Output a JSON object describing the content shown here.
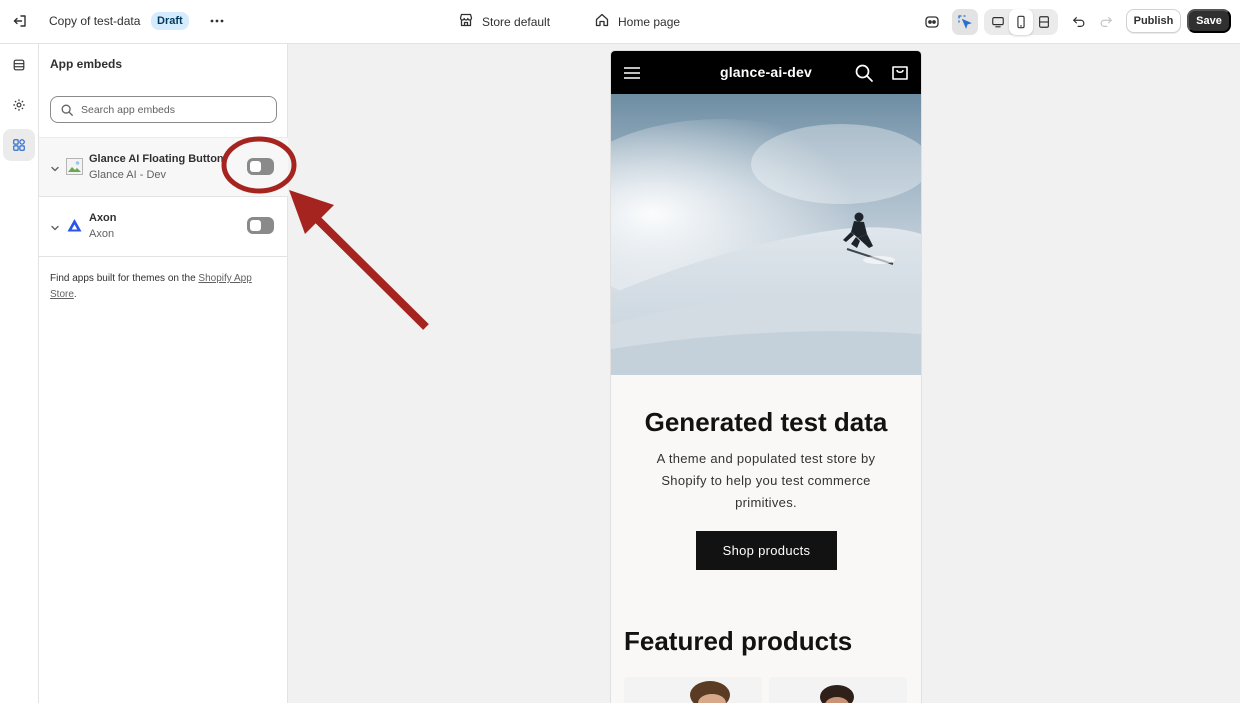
{
  "topbar": {
    "theme_name": "Copy of test-data",
    "status_badge": "Draft",
    "store_selector": "Store default",
    "page_selector": "Home page",
    "publish_label": "Publish",
    "save_label": "Save",
    "icons": [
      "exit-icon",
      "more-icon",
      "store-icon",
      "home-icon",
      "ai-assistant-icon",
      "inspector-icon",
      "desktop-view-icon",
      "mobile-view-icon",
      "fullscreen-icon",
      "undo-icon",
      "redo-icon"
    ]
  },
  "rail": {
    "items": [
      {
        "name": "sections",
        "icon": "sections-icon",
        "active": false
      },
      {
        "name": "theme-settings",
        "icon": "gear-icon",
        "active": false
      },
      {
        "name": "app-embeds",
        "icon": "apps-icon",
        "active": true
      }
    ]
  },
  "panel": {
    "title": "App embeds",
    "search_placeholder": "Search app embeds",
    "embeds": [
      {
        "name": "Glance AI Floating Button",
        "provider": "Glance AI - Dev",
        "enabled": false,
        "icon": "image-placeholder-icon"
      },
      {
        "name": "Axon",
        "provider": "Axon",
        "enabled": false,
        "icon": "axon-logo-icon"
      }
    ],
    "footnote_text": "Find apps built for themes on the ",
    "footnote_link": "Shopify App Store",
    "footnote_end": "."
  },
  "preview": {
    "store_name": "glance-ai-dev",
    "heading": "Generated test data",
    "description": "A theme and populated test store by Shopify to help you test commerce primitives.",
    "cta_label": "Shop products",
    "featured_heading": "Featured products"
  },
  "colors": {
    "annotation": "#a5241f",
    "save_button": "#303030",
    "badge_bg": "#d5ebff",
    "preview_header": "#000000"
  }
}
